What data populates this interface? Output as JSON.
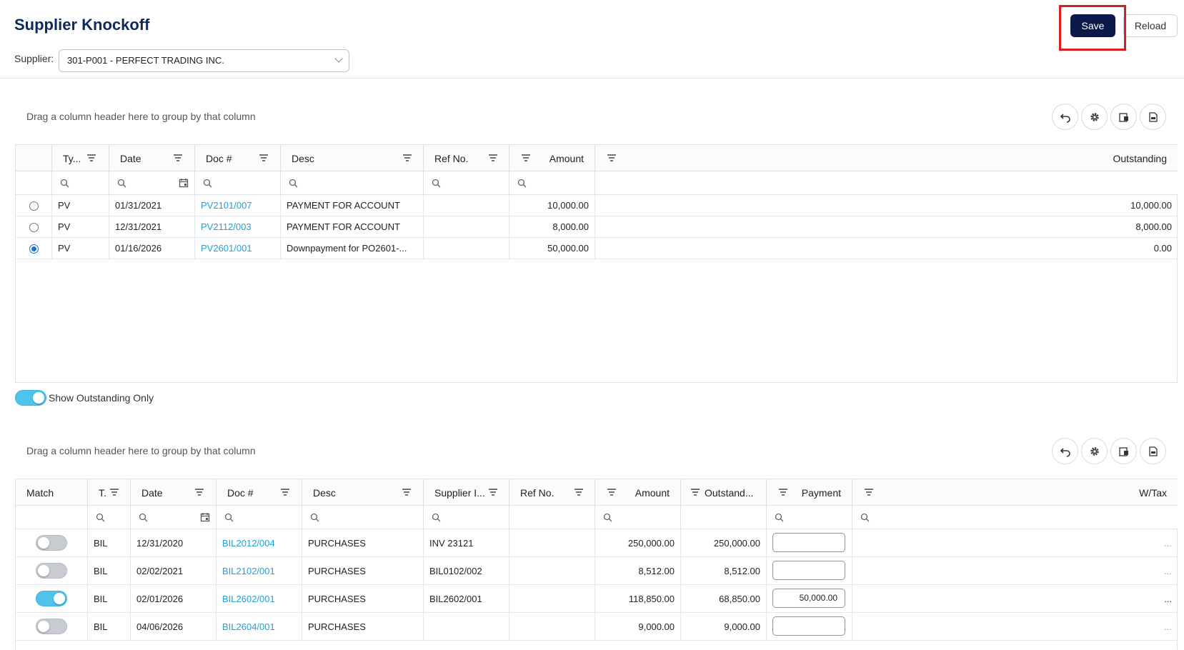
{
  "header": {
    "title": "Supplier Knockoff",
    "supplier_label": "Supplier:",
    "supplier_value": "301-P001 - PERFECT TRADING INC.",
    "save_label": "Save",
    "reload_label": "Reload"
  },
  "top_grid": {
    "group_hint": "Drag a column header here to group by that column",
    "columns": [
      "Ty...",
      "Date",
      "Doc #",
      "Desc",
      "Ref No.",
      "Amount",
      "Outstanding"
    ],
    "rows": [
      {
        "selected": false,
        "type": "PV",
        "date": "01/31/2021",
        "doc": "PV2101/007",
        "desc": "PAYMENT FOR ACCOUNT",
        "ref": "",
        "amount": "10,000.00",
        "outstanding": "10,000.00"
      },
      {
        "selected": false,
        "type": "PV",
        "date": "12/31/2021",
        "doc": "PV2112/003",
        "desc": "PAYMENT FOR ACCOUNT",
        "ref": "",
        "amount": "8,000.00",
        "outstanding": "8,000.00"
      },
      {
        "selected": true,
        "type": "PV",
        "date": "01/16/2026",
        "doc": "PV2601/001",
        "desc": "Downpayment for PO2601-...",
        "ref": "",
        "amount": "50,000.00",
        "outstanding": "0.00"
      }
    ]
  },
  "outstanding_toggle": {
    "label": "Show Outstanding Only",
    "on": true
  },
  "bottom_grid": {
    "group_hint": "Drag a column header here to group by that column",
    "columns": [
      "Match",
      "T.",
      "Date",
      "Doc #",
      "Desc",
      "Supplier I...",
      "Ref No.",
      "Amount",
      "Outstand...",
      "Payment",
      "W/Tax"
    ],
    "rows": [
      {
        "match": false,
        "type": "BIL",
        "date": "12/31/2020",
        "doc": "BIL2012/004",
        "desc": "PURCHASES",
        "supplier_inv": "INV 23121",
        "ref": "",
        "amount": "250,000.00",
        "outstanding": "250,000.00",
        "payment": "",
        "wtax": "..."
      },
      {
        "match": false,
        "type": "BIL",
        "date": "02/02/2021",
        "doc": "BIL2102/001",
        "desc": "PURCHASES",
        "supplier_inv": "BIL0102/002",
        "ref": "",
        "amount": "8,512.00",
        "outstanding": "8,512.00",
        "payment": "",
        "wtax": "..."
      },
      {
        "match": true,
        "type": "BIL",
        "date": "02/01/2026",
        "doc": "BIL2602/001",
        "desc": "PURCHASES",
        "supplier_inv": "BIL2602/001",
        "ref": "",
        "amount": "118,850.00",
        "outstanding": "68,850.00",
        "payment": "50,000.00",
        "wtax": "..."
      },
      {
        "match": false,
        "type": "BIL",
        "date": "04/06/2026",
        "doc": "BIL2604/001",
        "desc": "PURCHASES",
        "supplier_inv": "",
        "ref": "",
        "amount": "9,000.00",
        "outstanding": "9,000.00",
        "payment": "",
        "wtax": "..."
      }
    ]
  },
  "icons": {
    "undo": "undo-icon",
    "settings": "gear-icon",
    "export_excel": "export-excel-icon",
    "export_pdf": "export-pdf-icon",
    "filter": "filter-icon",
    "search": "search-icon",
    "calendar": "calendar-icon"
  },
  "colors": {
    "title": "#0d2a5c",
    "save_bg": "#0b1a4a",
    "link": "#21a0d8",
    "toggle_on": "#4fc4ea",
    "highlight": "#d91e1e"
  }
}
